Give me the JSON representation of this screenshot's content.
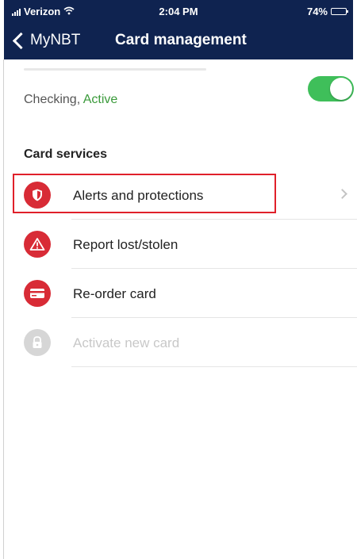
{
  "status_bar": {
    "carrier": "Verizon",
    "time": "2:04 PM",
    "battery": "74%",
    "battery_level": 0.74
  },
  "nav": {
    "back_label": "MyNBT",
    "title": "Card management"
  },
  "account": {
    "type": "Checking,",
    "status": "Active",
    "toggle_on": true
  },
  "card_services": {
    "header": "Card services",
    "items": [
      {
        "label": "Alerts and protections",
        "icon": "shield-icon",
        "enabled": true,
        "highlighted": true
      },
      {
        "label": "Report lost/stolen",
        "icon": "warning-icon",
        "enabled": true
      },
      {
        "label": "Re-order card",
        "icon": "card-icon",
        "enabled": true
      },
      {
        "label": "Activate new card",
        "icon": "lock-icon",
        "enabled": false
      }
    ]
  },
  "colors": {
    "nav_bg": "#0f2350",
    "accent_red": "#d82b36",
    "active_green": "#3a9a3a",
    "toggle_green": "#3fbf5a",
    "disabled_gray": "#d6d6d6"
  }
}
